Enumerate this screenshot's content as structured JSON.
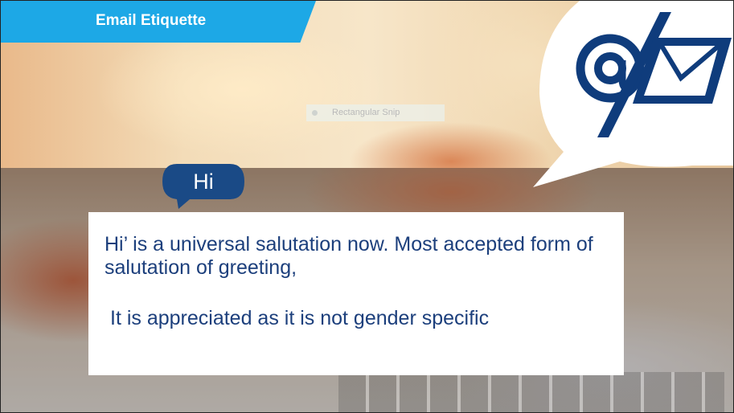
{
  "header": {
    "title": "Email Etiquette"
  },
  "overlay": {
    "snip_label": "Rectangular Snip"
  },
  "bubble": {
    "text": "Hi"
  },
  "panel": {
    "paragraph1": "Hi’ is a universal salutation now. Most accepted form of salutation of greeting,",
    "paragraph2": "It is appreciated as it is not gender specific"
  },
  "icons": {
    "logo": "email-at-envelope-icon"
  },
  "colors": {
    "banner": "#1da8e6",
    "text": "#1c3f7c",
    "navy": "#0f3c7c"
  }
}
